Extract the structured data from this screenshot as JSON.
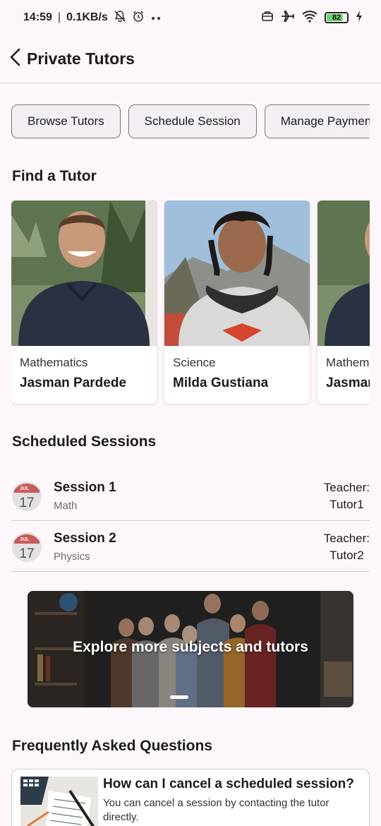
{
  "status_bar": {
    "time": "14:59",
    "network_speed": "0.1KB/s",
    "battery_level": "82",
    "battery_fraction": 0.82,
    "icons": [
      "muted-bell-icon",
      "alarm-icon",
      "more-dots-icon",
      "sim-icon",
      "airplane-icon",
      "wifi-icon",
      "battery-icon",
      "charging-icon"
    ]
  },
  "app_bar": {
    "title": "Private Tutors"
  },
  "chips": [
    {
      "label": "Browse Tutors"
    },
    {
      "label": "Schedule Session"
    },
    {
      "label": "Manage Payments"
    }
  ],
  "find_tutor": {
    "title": "Find a Tutor",
    "tutors": [
      {
        "subject": "Mathematics",
        "name": "Jasman Pardede"
      },
      {
        "subject": "Science",
        "name": "Milda Gustiana"
      },
      {
        "subject": "Mathematics",
        "name": "Jasman Pardede"
      }
    ]
  },
  "scheduled": {
    "title": "Scheduled Sessions",
    "calendar_month": "JUL",
    "calendar_day": "17",
    "sessions": [
      {
        "title": "Session 1",
        "subject": "Math",
        "teacher_label": "Teacher:",
        "teacher": "Tutor1"
      },
      {
        "title": "Session 2",
        "subject": "Physics",
        "teacher_label": "Teacher:",
        "teacher": "Tutor2"
      }
    ]
  },
  "banner": {
    "text": "Explore more subjects and tutors"
  },
  "faq": {
    "title": "Frequently Asked Questions",
    "items": [
      {
        "question": "How can I cancel a scheduled session?",
        "answer": "You can cancel a session by contacting the tutor directly."
      }
    ]
  },
  "colors": {
    "background": "#fdf7fb",
    "chip_border": "#79747e",
    "divider": "#cfcbd2",
    "calendar_red": "#c95a5a"
  }
}
